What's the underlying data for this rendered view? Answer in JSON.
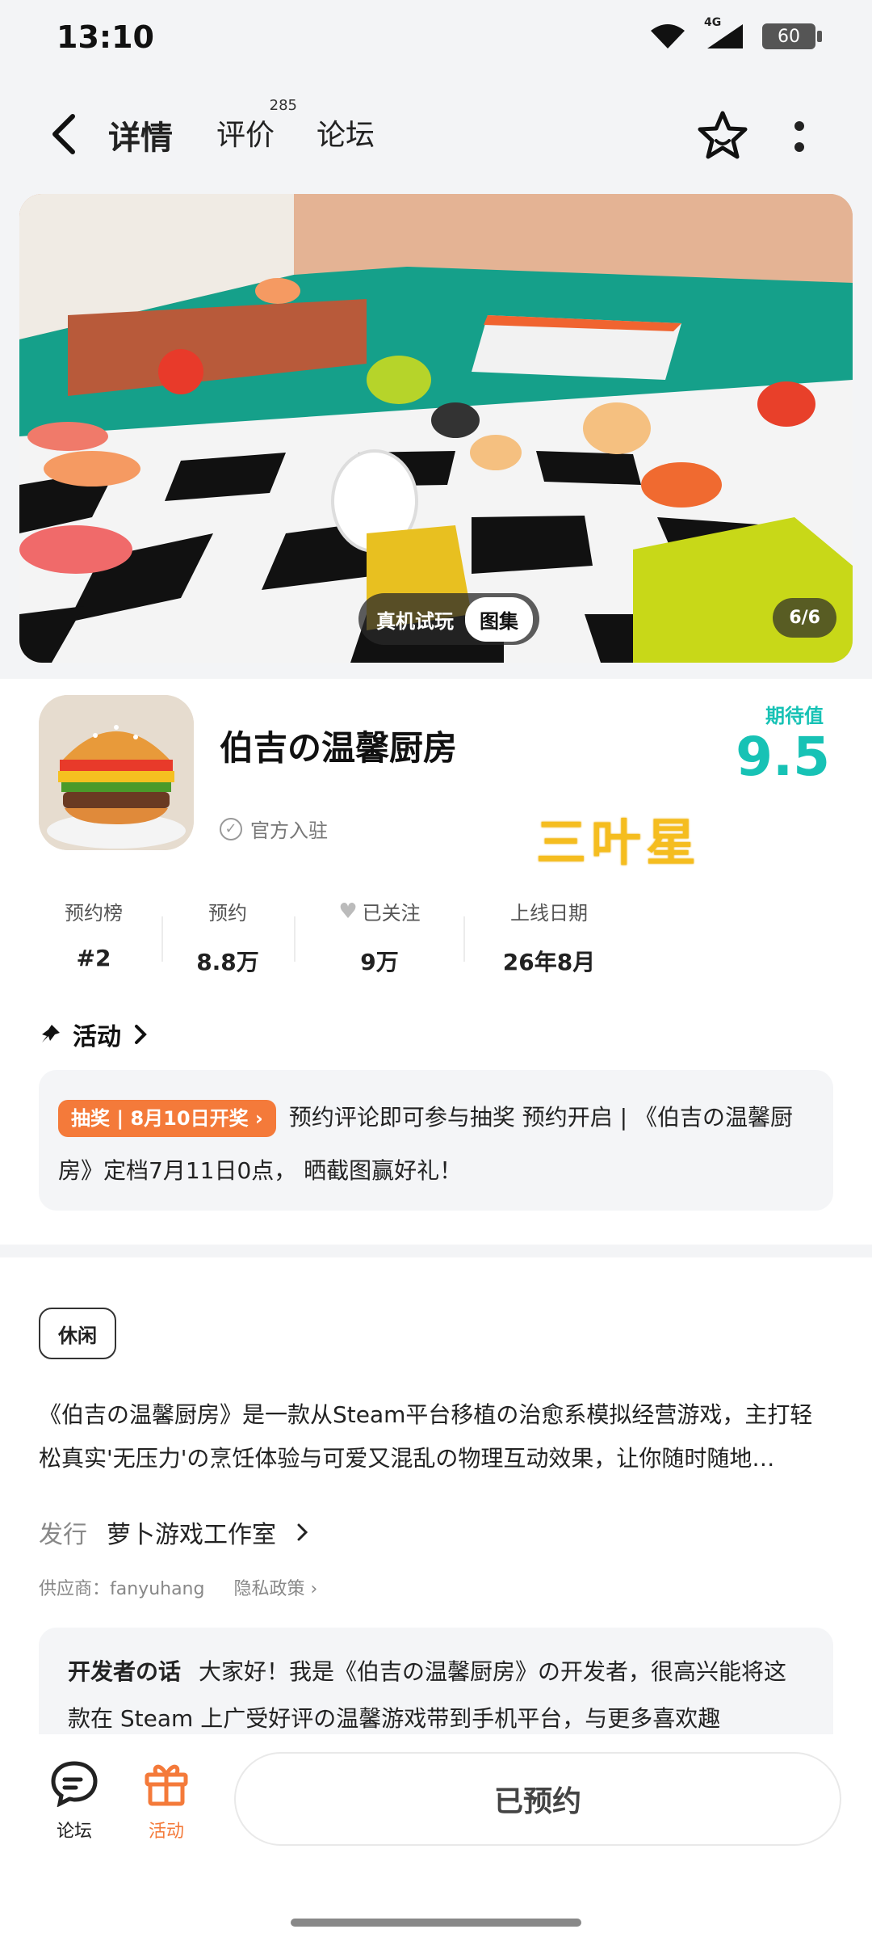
{
  "status_bar": {
    "time": "13:10",
    "network": "4G",
    "battery": "60"
  },
  "nav": {
    "tabs": [
      {
        "label": "详情"
      },
      {
        "label": "评价",
        "count": "285"
      },
      {
        "label": "论坛"
      }
    ]
  },
  "hero": {
    "trial_label": "真机试玩",
    "gallery_label": "图集",
    "counter": "6/6"
  },
  "game": {
    "title": "伯吉の温馨厨房",
    "official_label": "官方入驻",
    "watermark_text": "三叶星",
    "expect_label": "期待值",
    "expect_value": "9.5"
  },
  "stats": [
    {
      "label": "预约榜",
      "value": "#2"
    },
    {
      "label": "预约",
      "value": "8.8万"
    },
    {
      "label": "已关注",
      "value": "9万"
    },
    {
      "label": "上线日期",
      "value": "26年8月"
    }
  ],
  "activity": {
    "title": "活动",
    "badge": "抽奖 | 8月10日开奖",
    "text": "预约评论即可参与抽奖 预约开启 | 《伯吉の温馨厨房》定档7月11日0点， 晒截图赢好礼！"
  },
  "description": {
    "tag": "休闲",
    "text": "《伯吉の温馨厨房》是一款从Steam平台移植の治愈系模拟经营游戏，主打轻松真实'无压力'の烹饪体验与可爱又混乱の物理互动效果，让你随时随地…",
    "publisher_label": "发行",
    "publisher_value": "萝卜游戏工作室",
    "supplier": "供应商：fanyuhang",
    "privacy": "隐私政策"
  },
  "developer": {
    "label": "开发者の话",
    "text": "大家好！我是《伯吉の温馨厨房》の开发者，很高兴能将这款在 Steam 上广受好评の温馨游戏带到手机平台，与更多喜欢趣"
  },
  "bottom_bar": {
    "forum_label": "论坛",
    "activity_label": "活动",
    "reserve_label": "已预约"
  },
  "colors": {
    "accent": "#17c2b5",
    "orange": "#f47a3a",
    "watermark": "#f5bd1f"
  }
}
